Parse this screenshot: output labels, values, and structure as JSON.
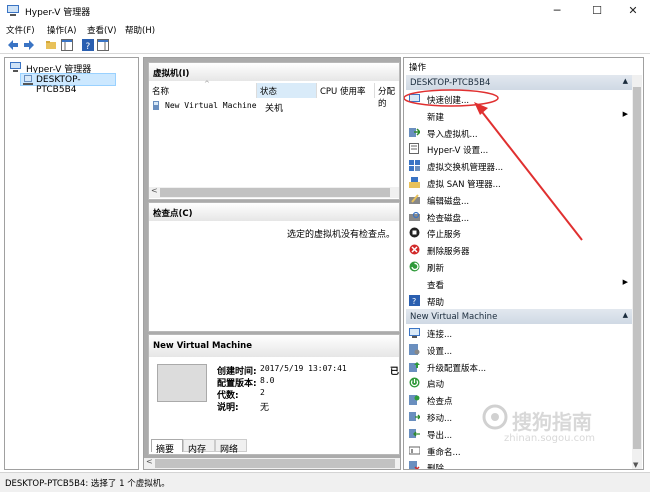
{
  "window": {
    "title": "Hyper-V 管理器"
  },
  "menu": [
    "文件(F)",
    "操作(A)",
    "查看(V)",
    "帮助(H)"
  ],
  "tree": {
    "root": "Hyper-V 管理器",
    "host": "DESKTOP-PTCB5B4"
  },
  "vm_list": {
    "title": "虚拟机(I)",
    "columns": [
      "名称",
      "状态",
      "CPU 使用率",
      "分配的"
    ],
    "rows": [
      {
        "name": "New Virtual Machine",
        "state": "关机"
      }
    ]
  },
  "checkpoints": {
    "title": "检查点(C)",
    "empty_text": "选定的虚拟机没有检查点。"
  },
  "details": {
    "title": "New Virtual Machine",
    "fields": [
      {
        "label": "创建时间:",
        "value": "2017/5/19 13:07:41"
      },
      {
        "label": "配置版本:",
        "value": "8.0"
      },
      {
        "label": "代数:",
        "value": "2"
      },
      {
        "label": "说明:",
        "value": "无"
      }
    ],
    "clipped_label": "已",
    "tabs": [
      "摘要",
      "内存",
      "网络"
    ]
  },
  "actions": {
    "header": "操作",
    "host_group": "DESKTOP-PTCB5B4",
    "host_items": [
      {
        "label": "快速创建...",
        "icon": "quick-create-icon"
      },
      {
        "label": "新建",
        "icon": "none",
        "submenu": true
      },
      {
        "label": "导入虚拟机...",
        "icon": "import-icon"
      },
      {
        "label": "Hyper-V 设置...",
        "icon": "settings-icon"
      },
      {
        "label": "虚拟交换机管理器...",
        "icon": "switch-icon"
      },
      {
        "label": "虚拟 SAN 管理器...",
        "icon": "san-icon"
      },
      {
        "label": "编辑磁盘...",
        "icon": "edit-disk-icon"
      },
      {
        "label": "检查磁盘...",
        "icon": "inspect-disk-icon"
      },
      {
        "label": "停止服务",
        "icon": "stop-icon"
      },
      {
        "label": "删除服务器",
        "icon": "delete-icon"
      },
      {
        "label": "刷新",
        "icon": "refresh-icon"
      },
      {
        "label": "查看",
        "icon": "none",
        "submenu": true
      },
      {
        "label": "帮助",
        "icon": "help-icon"
      }
    ],
    "vm_group": "New Virtual Machine",
    "vm_items": [
      {
        "label": "连接...",
        "icon": "connect-icon"
      },
      {
        "label": "设置...",
        "icon": "vm-settings-icon"
      },
      {
        "label": "升级配置版本...",
        "icon": "upgrade-icon"
      },
      {
        "label": "启动",
        "icon": "start-icon"
      },
      {
        "label": "检查点",
        "icon": "checkpoint-icon"
      },
      {
        "label": "移动...",
        "icon": "move-icon"
      },
      {
        "label": "导出...",
        "icon": "export-icon"
      },
      {
        "label": "重命名...",
        "icon": "rename-icon"
      },
      {
        "label": "删除...",
        "icon": "vm-delete-icon"
      }
    ]
  },
  "status": {
    "text": "DESKTOP-PTCB5B4:  选择了 1 个虚拟机。"
  },
  "watermark": {
    "text": "搜狗指南",
    "url": "zhinan.sogou.com"
  },
  "colors": {
    "accent": "#e03030",
    "selection": "#cce8ff",
    "group_header": "#d8e1eb"
  }
}
